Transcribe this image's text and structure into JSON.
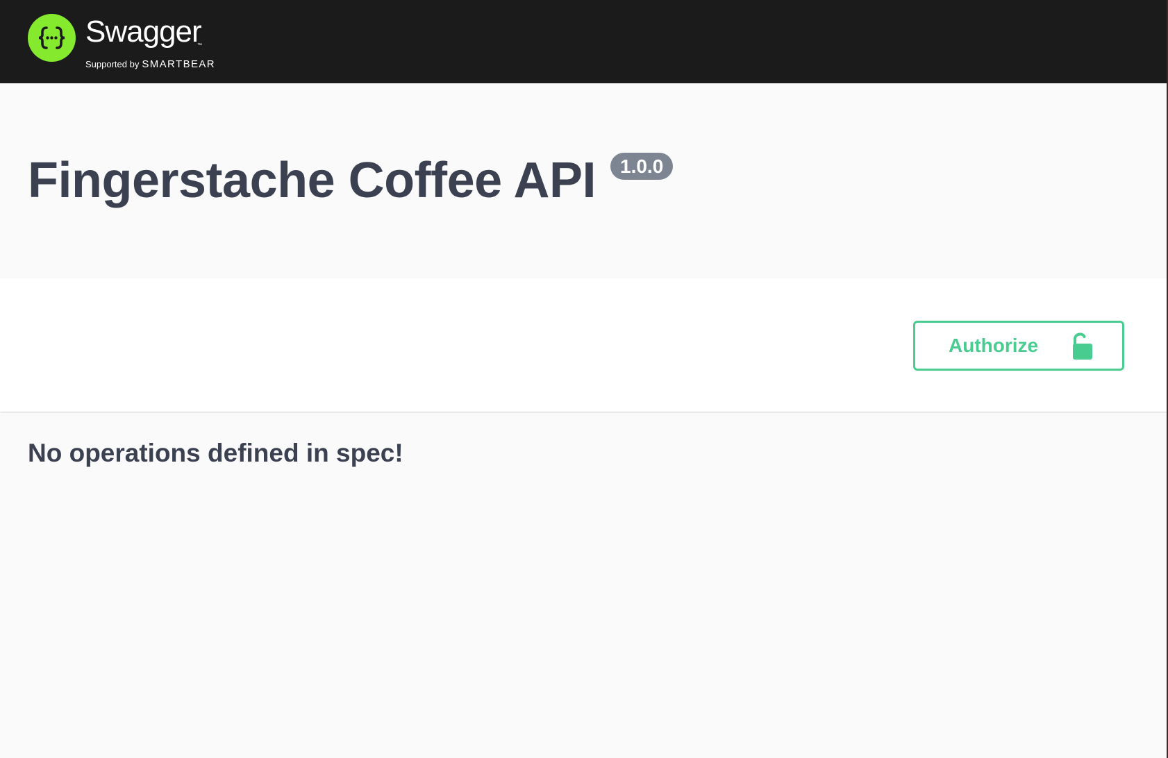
{
  "header": {
    "brand_name": "Swagger",
    "trademark": "™",
    "supported_by": "Supported by",
    "company": "SMARTBEAR",
    "logo_symbol": "{···}",
    "logo_color": "#85ea2d",
    "background": "#1b1b1b"
  },
  "info": {
    "title": "Fingerstache Coffee API",
    "version": "1.0.0"
  },
  "scheme_container": {
    "authorize_label": "Authorize",
    "authorize_icon": "unlocked-padlock-icon",
    "accent_color": "#49cc90"
  },
  "operations": {
    "empty_message": "No operations defined in spec!"
  }
}
